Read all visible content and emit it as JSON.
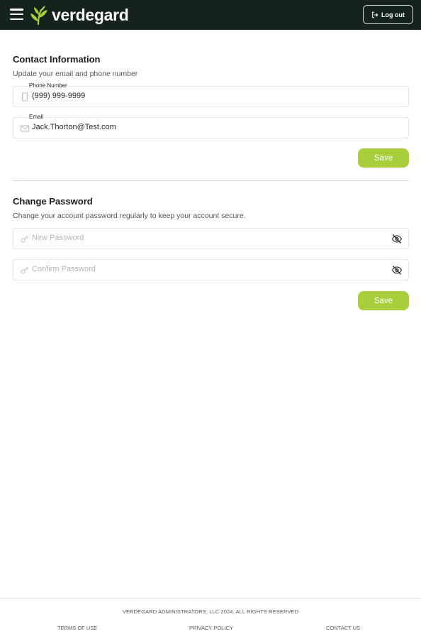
{
  "header": {
    "brand": "verdegard",
    "logout_label": "Log out",
    "background": "#16231d"
  },
  "contact": {
    "title": "Contact Information",
    "subtitle": "Update your email and phone number",
    "phone": {
      "label": "Phone Number",
      "value": "(999) 999-9999",
      "icon": "phone-icon"
    },
    "email": {
      "label": "Email",
      "value": "Jack.Thorton@Test.com",
      "icon": "mail-icon"
    },
    "save_label": "Save"
  },
  "password": {
    "title": "Change Password",
    "subtitle": "Change your account password regularly to keep your account secure.",
    "new_placeholder": "New Password",
    "confirm_placeholder": "Confirm Password",
    "save_label": "Save"
  },
  "footer": {
    "copyright": "VERDEGARD ADMINISTRATORS, LLC 2024, ALL RIGHTS RESERVED",
    "links": [
      "TERMS OF USE",
      "PRIVACY POLICY",
      "CONTACT US"
    ]
  },
  "colors": {
    "accent": "#a8cf3a",
    "header": "#16231d",
    "logo_leaf": "#a8cf3a"
  }
}
